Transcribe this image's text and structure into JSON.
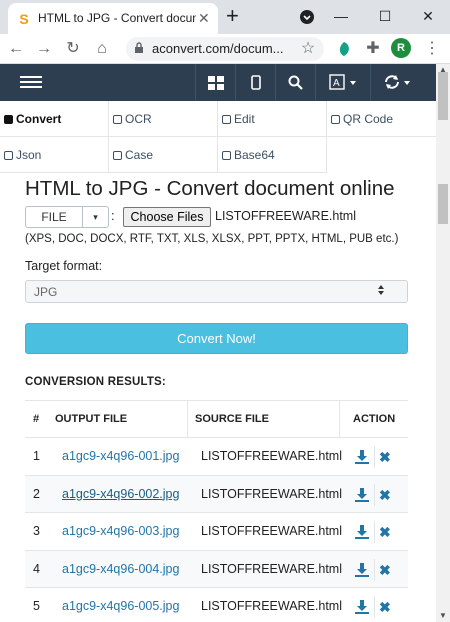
{
  "browser": {
    "tab_title": "HTML to JPG - Convert docume",
    "tab_favicon": "S",
    "close_glyph": "✕",
    "newtab_glyph": "+",
    "url": "aconvert.com/docum...",
    "avatar_letter": "R",
    "nav": {
      "back": "←",
      "forward": "→",
      "reload": "↻",
      "home": "⌂",
      "star": "☆",
      "ext": "✚",
      "menu": "⋮"
    },
    "window": {
      "minimize": "—",
      "maximize": "☐",
      "close": "✕"
    }
  },
  "sitenav": {
    "icons": [
      "grid-icon",
      "mobile-icon",
      "search-icon",
      "translate-icon",
      "sync-icon"
    ]
  },
  "tools": [
    {
      "label": "Convert",
      "active": true
    },
    {
      "label": "OCR",
      "active": false
    },
    {
      "label": "Edit",
      "active": false
    },
    {
      "label": "QR Code",
      "active": false
    },
    {
      "label": "Json",
      "active": false
    },
    {
      "label": "Case",
      "active": false
    },
    {
      "label": "Base64",
      "active": false
    }
  ],
  "main": {
    "title": "HTML to JPG - Convert document online",
    "file_button": "FILE",
    "file_caret": "▾",
    "colon": ":",
    "choose_button": "Choose Files",
    "chosen_file": "LISTOFFREEWARE.html",
    "formats_note": "(XPS, DOC, DOCX, RTF, TXT, XLS, XLSX, PPT, PPTX, HTML, PUB etc.)",
    "target_label": "Target format:",
    "target_value": "JPG",
    "select_arrow": "▲▼",
    "convert_button": "Convert Now!",
    "results_heading": "CONVERSION RESULTS:"
  },
  "results": {
    "headers": {
      "num": "#",
      "output": "OUTPUT FILE",
      "source": "SOURCE FILE",
      "action": "ACTION"
    },
    "rows": [
      {
        "num": "1",
        "output": "a1gc9-x4q96-001.jpg",
        "source": "LISTOFFREEWARE.html"
      },
      {
        "num": "2",
        "output": "a1gc9-x4q96-002.jpg",
        "source": "LISTOFFREEWARE.html"
      },
      {
        "num": "3",
        "output": "a1gc9-x4q96-003.jpg",
        "source": "LISTOFFREEWARE.html"
      },
      {
        "num": "4",
        "output": "a1gc9-x4q96-004.jpg",
        "source": "LISTOFFREEWARE.html"
      },
      {
        "num": "5",
        "output": "a1gc9-x4q96-005.jpg",
        "source": "LISTOFFREEWARE.html"
      }
    ],
    "delete_glyph": "✖"
  },
  "colors": {
    "navbar": "#2c3e50",
    "convert_button": "#4bbfe0",
    "link": "#2275a7"
  }
}
